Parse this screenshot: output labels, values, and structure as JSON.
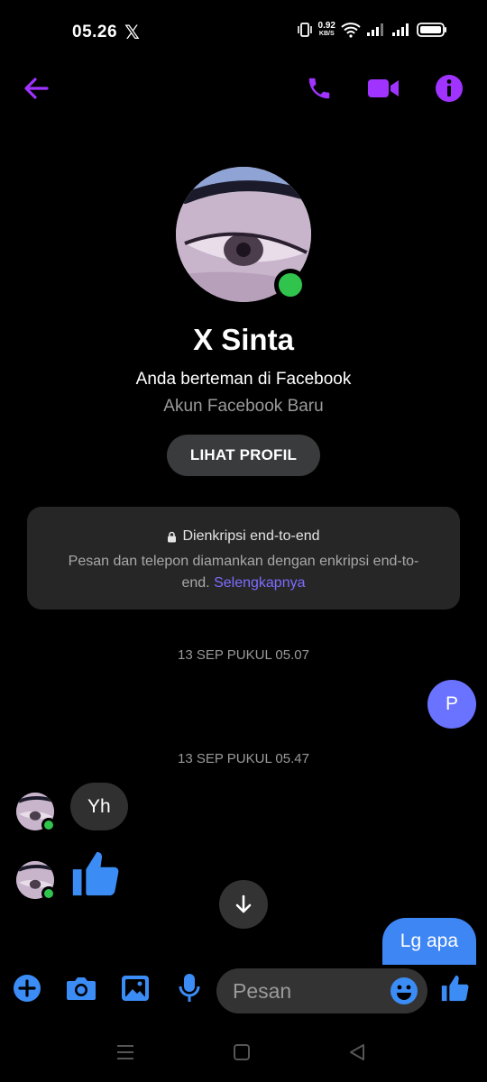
{
  "status": {
    "time": "05.26",
    "notif_icon": "x-logo-icon",
    "net_speed_value": "0.92",
    "net_speed_unit": "KB/S"
  },
  "contact": {
    "name": "X Sinta",
    "relation": "Anda berteman di Facebook",
    "account_note": "Akun Facebook Baru",
    "view_profile_label": "LIHAT PROFIL",
    "online": true
  },
  "encryption": {
    "title": "Dienkripsi end-to-end",
    "body": "Pesan dan telepon diamankan dengan enkripsi end-to-end.",
    "link": "Selengkapnya"
  },
  "messages": {
    "ts1": "13 SEP PUKUL 05.07",
    "out1": "P",
    "ts2": "13 SEP PUKUL 05.47",
    "in1": "Yh",
    "in2_icon": "thumbs-up-icon",
    "out2": "Lg apa"
  },
  "composer": {
    "placeholder": "Pesan"
  },
  "colors": {
    "accent_purple": "#a033ff",
    "outgoing_blue": "#3f86f5",
    "composer_blue": "#3b8cf5",
    "online_green": "#31c44d",
    "bubble_p": "#6a73ff"
  }
}
